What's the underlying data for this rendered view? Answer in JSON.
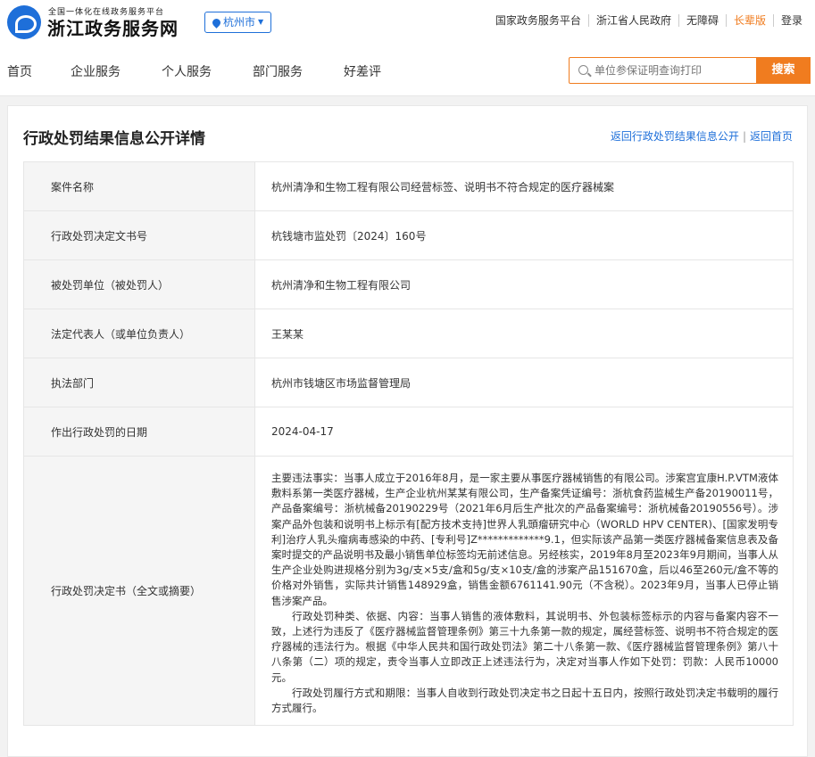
{
  "header": {
    "brand_sub": "全国一体化在线政务服务平台",
    "brand_main": "浙江政务服务网",
    "city": "杭州市",
    "links": [
      "国家政务服务平台",
      "浙江省人民政府",
      "无障碍",
      "长辈版",
      "登录"
    ]
  },
  "nav": {
    "items": [
      "首页",
      "企业服务",
      "个人服务",
      "部门服务",
      "好差评"
    ],
    "search_placeholder": "单位参保证明查询打印",
    "search_button": "搜索"
  },
  "main": {
    "title": "行政处罚结果信息公开详情",
    "crumb_back": "返回行政处罚结果信息公开",
    "crumb_home": "返回首页",
    "crumb_sep": "|",
    "rows": [
      {
        "label": "案件名称",
        "value": "杭州清净和生物工程有限公司经营标签、说明书不符合规定的医疗器械案"
      },
      {
        "label": "行政处罚决定文书号",
        "value": "杭钱塘市监处罚〔2024〕160号"
      },
      {
        "label": "被处罚单位（被处罚人）",
        "value": "杭州清净和生物工程有限公司"
      },
      {
        "label": "法定代表人（或单位负责人）",
        "value": "王某某"
      },
      {
        "label": "执法部门",
        "value": "杭州市钱塘区市场监督管理局"
      },
      {
        "label": "作出行政处罚的日期",
        "value": "2024-04-17"
      }
    ],
    "decision_label": "行政处罚决定书（全文或摘要）",
    "decision_paragraphs": [
      "主要违法事实：当事人成立于2016年8月，是一家主要从事医疗器械销售的有限公司。涉案宫宜康H.P.VTM液体敷料系第一类医疗器械，生产企业杭州某某有限公司，生产备案凭证编号：浙杭食药监械生产备20190011号，产品备案编号：浙杭械备20190229号（2021年6月后生产批次的产品备案编号：浙杭械备20190556号）。涉案产品外包装和说明书上标示有[配方技术支持]世界人乳頭瘤研究中心（WORLD HPV CENTER)、[国家发明专利]治疗人乳头瘤病毒感染的中药、[专利号]Z*************9.1，但实际该产品第一类医疗器械备案信息表及备案时提交的产品说明书及最小销售单位标签均无前述信息。另经核实，2019年8月至2023年9月期间，当事人从生产企业处购进规格分别为3g/支×5支/盒和5g/支×10支/盒的涉案产品151670盒，后以46至260元/盒不等的价格对外销售，实际共计销售148929盒，销售金额6761141.90元（不含税）。2023年9月，当事人已停止销售涉案产品。",
      "行政处罚种类、依据、内容：当事人销售的液体敷料，其说明书、外包装标签标示的内容与备案内容不一致，上述行为违反了《医疗器械监督管理条例》第三十九条第一款的规定，属经营标签、说明书不符合规定的医疗器械的违法行为。根据《中华人民共和国行政处罚法》第二十八条第一款、《医疗器械监督管理条例》第八十八条第（二）项的规定，责令当事人立即改正上述违法行为，决定对当事人作如下处罚：罚款：人民币10000元。",
      "行政处罚履行方式和期限：当事人自收到行政处罚决定书之日起十五日内，按照行政处罚决定书载明的履行方式履行。"
    ]
  },
  "colors": {
    "accent": "#f07c1f",
    "brand": "#1e6fd9"
  }
}
